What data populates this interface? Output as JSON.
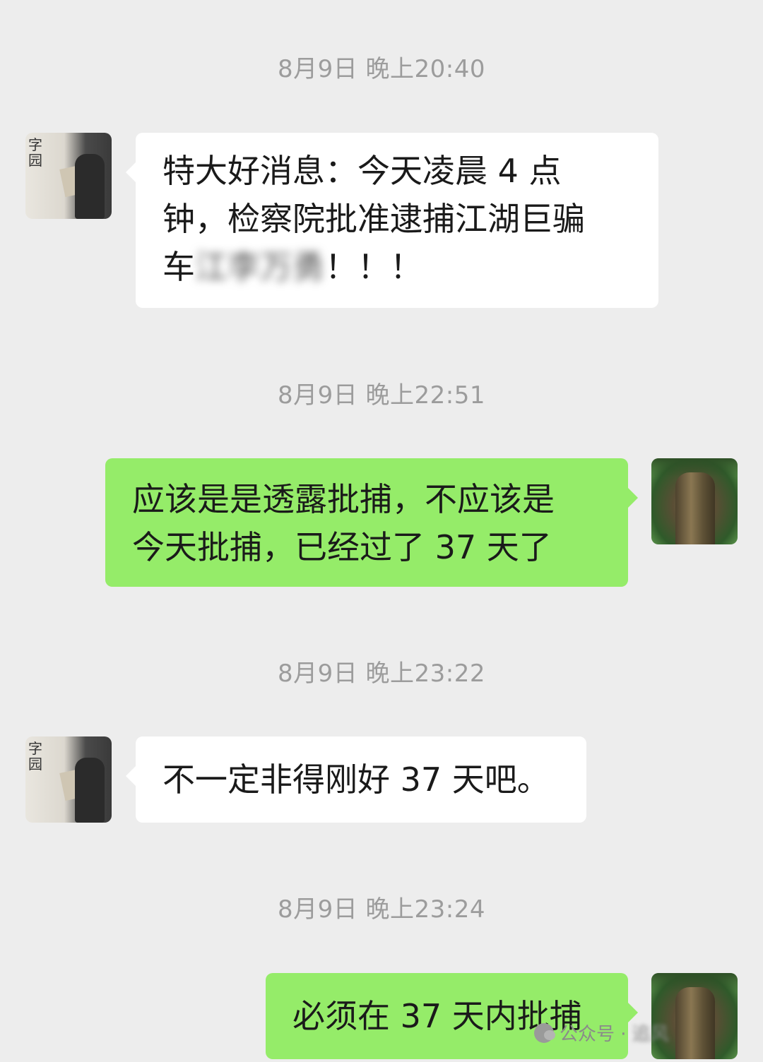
{
  "messages": [
    {
      "timestamp": "8月9日 晚上20:40",
      "side": "incoming",
      "text_lines": [
        "特大好消息：今天凌晨 4 点",
        "钟，检察院批准逮捕江湖巨骗"
      ],
      "text_last_prefix": "车",
      "text_last_redacted": "江李万勇",
      "text_last_suffix": "！！！"
    },
    {
      "timestamp": "8月9日 晚上22:51",
      "side": "outgoing",
      "text_lines": [
        "应该是是透露批捕，不应该是",
        "今天批捕，已经过了 37 天了"
      ]
    },
    {
      "timestamp": "8月9日 晚上23:22",
      "side": "incoming",
      "text_lines": [
        "不一定非得刚好 37 天吧。"
      ]
    },
    {
      "timestamp": "8月9日 晚上23:24",
      "side": "outgoing",
      "text_lines": [
        "必须在 37 天内批捕"
      ]
    }
  ],
  "watermark": {
    "text": "公众号 · ",
    "redacted": "追风"
  },
  "colors": {
    "background": "#ededed",
    "incoming_bubble": "#ffffff",
    "outgoing_bubble": "#95ec69",
    "timestamp": "#9c9c9c"
  },
  "icons": {
    "left_avatar": "calligraphy-person-avatar",
    "right_avatar": "tree-avatar"
  }
}
